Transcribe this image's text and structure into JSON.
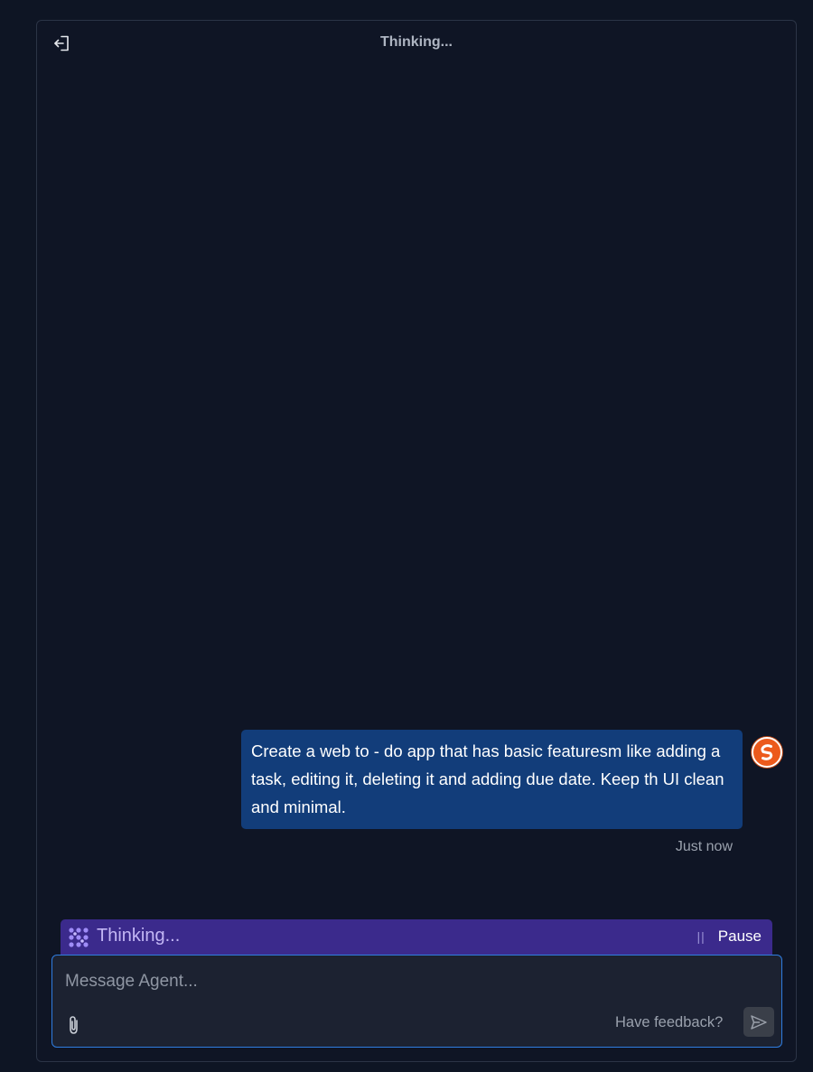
{
  "header": {
    "title": "Thinking...",
    "exit_icon": "exit-icon"
  },
  "chat": {
    "messages": [
      {
        "role": "user",
        "text": "Create a web to - do app that has basic featuresm like adding a task, editing it, deleting it and adding due date. Keep th UI clean and minimal.",
        "timestamp": "Just now",
        "avatar_icon": "user-avatar-icon"
      }
    ]
  },
  "status": {
    "text": "Thinking...",
    "pause_label": "Pause",
    "icon": "agent-dots-icon"
  },
  "composer": {
    "placeholder": "Message Agent...",
    "value": "",
    "feedback_label": "Have feedback?",
    "attach_icon": "paperclip-icon",
    "send_icon": "send-icon"
  },
  "colors": {
    "background": "#0e1524",
    "bubble": "#123d7a",
    "status_bar": "#3b2a8c",
    "composer_border": "#2f7de0",
    "avatar": "#ec5a1c"
  }
}
